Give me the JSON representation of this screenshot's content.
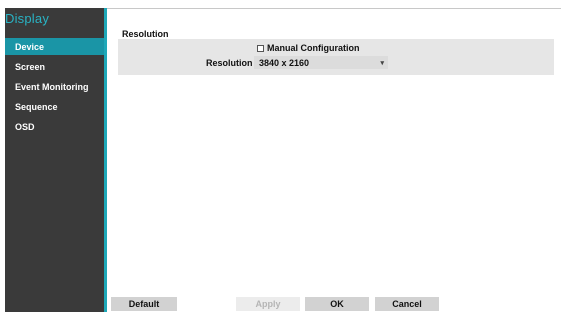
{
  "sidebar": {
    "title": "Display",
    "items": [
      {
        "label": "Device",
        "active": true
      },
      {
        "label": "Screen"
      },
      {
        "label": "Event Monitoring"
      },
      {
        "label": "Sequence"
      },
      {
        "label": "OSD"
      }
    ]
  },
  "main": {
    "section_title": "Resolution",
    "manual_config_label": "Manual Configuration",
    "manual_config_checked": false,
    "resolution_label": "Resolution",
    "resolution_value": "3840 x 2160"
  },
  "footer": {
    "default_label": "Default",
    "apply_label": "Apply",
    "ok_label": "OK",
    "cancel_label": "Cancel"
  },
  "colors": {
    "accent": "#1ea8b8",
    "sidebar_bg": "#3a3a3a",
    "active_item_bg": "#1a95a6"
  }
}
